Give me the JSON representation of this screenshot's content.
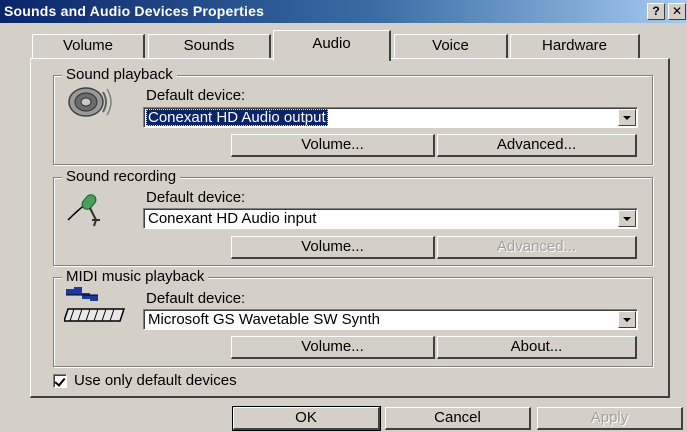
{
  "window": {
    "title": "Sounds and Audio Devices Properties",
    "help_button": "?",
    "close_button": "✕"
  },
  "tabs": [
    {
      "label": "Volume",
      "active": false
    },
    {
      "label": "Sounds",
      "active": false
    },
    {
      "label": "Audio",
      "active": true
    },
    {
      "label": "Voice",
      "active": false
    },
    {
      "label": "Hardware",
      "active": false
    }
  ],
  "playback": {
    "group_label": "Sound playback",
    "device_label": "Default device:",
    "device_value": "Conexant HD Audio output",
    "volume_button": "Volume...",
    "advanced_button": "Advanced..."
  },
  "recording": {
    "group_label": "Sound recording",
    "device_label": "Default device:",
    "device_value": "Conexant HD Audio input",
    "volume_button": "Volume...",
    "advanced_button": "Advanced..."
  },
  "midi": {
    "group_label": "MIDI music playback",
    "device_label": "Default device:",
    "device_value": "Microsoft GS Wavetable SW Synth",
    "volume_button": "Volume...",
    "about_button": "About..."
  },
  "options": {
    "use_default_label": "Use only default devices",
    "use_default_checked": true
  },
  "footer": {
    "ok": "OK",
    "cancel": "Cancel",
    "apply": "Apply"
  },
  "icons": {
    "playback": "speaker-icon",
    "recording": "microphone-icon",
    "midi": "midi-keyboard-icon"
  }
}
